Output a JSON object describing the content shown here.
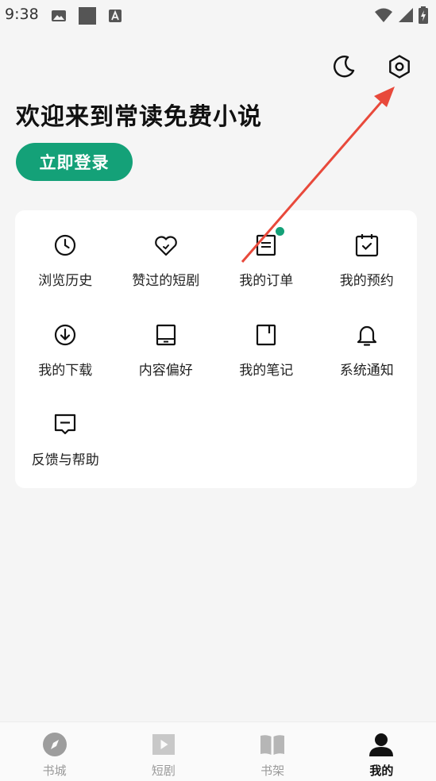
{
  "status_bar": {
    "time": "9:38",
    "left_icons": [
      "image-icon",
      "square-icon",
      "font-icon"
    ],
    "right_icons": [
      "wifi-icon",
      "signal-icon",
      "battery-charging-icon"
    ]
  },
  "header": {
    "welcome_text": "欢迎来到常读免费小说",
    "login_label": "立即登录",
    "actions": [
      "dark-mode-moon-icon",
      "settings-gear-icon"
    ]
  },
  "menu": {
    "items": [
      {
        "label": "浏览历史",
        "icon": "clock-icon"
      },
      {
        "label": "赞过的短剧",
        "icon": "heart-icon"
      },
      {
        "label": "我的订单",
        "icon": "order-doc-icon",
        "has_dot": true
      },
      {
        "label": "我的预约",
        "icon": "calendar-check-icon"
      },
      {
        "label": "我的下载",
        "icon": "download-icon"
      },
      {
        "label": "内容偏好",
        "icon": "tablet-icon"
      },
      {
        "label": "我的笔记",
        "icon": "notebook-icon"
      },
      {
        "label": "系统通知",
        "icon": "bell-icon"
      },
      {
        "label": "反馈与帮助",
        "icon": "feedback-icon"
      }
    ]
  },
  "bottom_nav": {
    "items": [
      {
        "label": "书城",
        "icon": "compass-icon",
        "active": false
      },
      {
        "label": "短剧",
        "icon": "play-icon",
        "active": false
      },
      {
        "label": "书架",
        "icon": "book-icon",
        "active": false
      },
      {
        "label": "我的",
        "icon": "person-icon",
        "active": true
      }
    ]
  },
  "colors": {
    "accent": "#14a178",
    "annotation_arrow": "#e8493b",
    "background": "#f5f5f5"
  }
}
